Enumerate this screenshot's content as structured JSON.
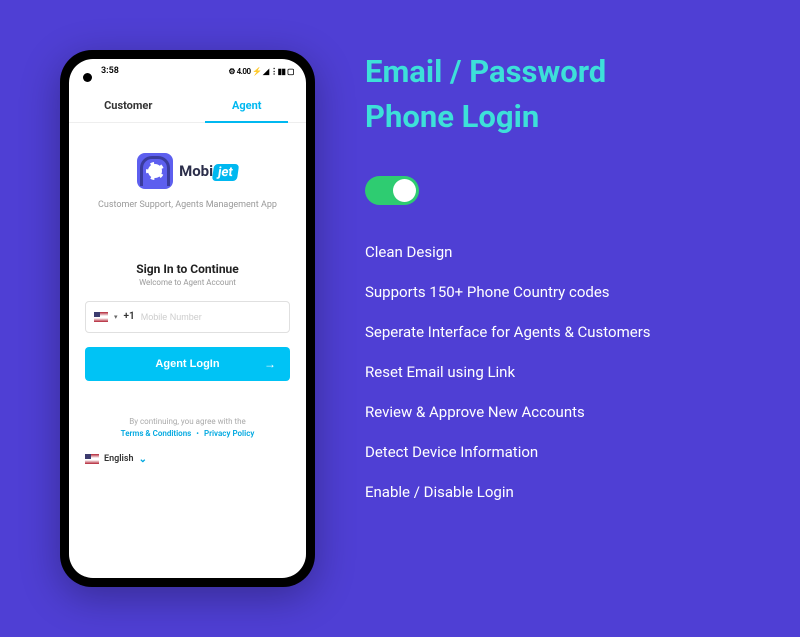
{
  "phone": {
    "status": {
      "time": "3:58",
      "ampm_hint": "",
      "icons_text": "⚙ 4.00 ⚡ ◢ ⋮▮▮ ▢"
    },
    "tabs": [
      {
        "label": "Customer",
        "active": false
      },
      {
        "label": "Agent",
        "active": true
      }
    ],
    "brand": {
      "name_prefix": "Mobi",
      "name_accent": "jet"
    },
    "tagline": "Customer Support, Agents Management App",
    "signin": {
      "title": "Sign In to Continue",
      "subtitle": "Welcome to Agent Account",
      "dial_code": "+1",
      "placeholder": "Mobile Number",
      "button": "Agent LogIn"
    },
    "legal": {
      "prefix": "By continuing, you agree with the",
      "terms": "Terms & Conditions",
      "privacy": "Privacy Policy"
    },
    "language": {
      "label": "English"
    }
  },
  "right": {
    "headline_line1": "Email / Password",
    "headline_line2": "Phone Login",
    "toggle_on": true,
    "features": [
      "Clean Design",
      "Supports 150+ Phone Country codes",
      "Seperate Interface for Agents & Customers",
      "Reset Email using Link",
      "Review & Approve New Accounts",
      "Detect Device Information",
      "Enable / Disable Login"
    ]
  }
}
